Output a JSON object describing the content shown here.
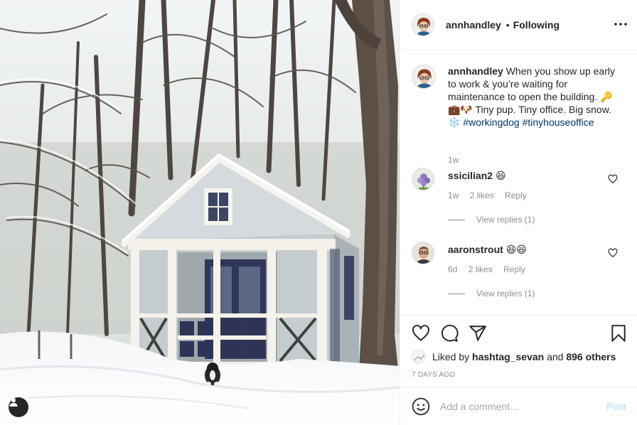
{
  "header": {
    "username": "annhandley",
    "separator": "•",
    "follow_status": "Following"
  },
  "caption": {
    "username": "annhandley",
    "text": "When you show up early to work & you’re waiting for maintenance to open the building. 🔑 💼🐶 Tiny pup. Tiny office. Big snow. ❄️",
    "hashtag_1": "#workingdog",
    "hashtag_2": "#tinyhouseoffice",
    "time": "1w"
  },
  "comments": [
    {
      "username": "ssicilian2",
      "text": "😆",
      "time": "1w",
      "likes": "2 likes",
      "reply": "Reply",
      "replies": "View replies (1)"
    },
    {
      "username": "aaronstrout",
      "text": "😆😆",
      "time": "6d",
      "likes": "2 likes",
      "reply": "Reply",
      "replies": "View replies (1)"
    }
  ],
  "likes": {
    "prefix": "Liked by",
    "user": "hashtag_sevan",
    "joiner": "and",
    "others": "896 others"
  },
  "posted": "7 DAYS AGO",
  "add_comment": {
    "placeholder": "Add a comment…",
    "post_label": "Post"
  },
  "colors": {
    "text": "#262626",
    "secondary": "#8e8e8e",
    "link": "#00376b",
    "post_disabled": "#b2dffc",
    "divider": "#efefef"
  }
}
